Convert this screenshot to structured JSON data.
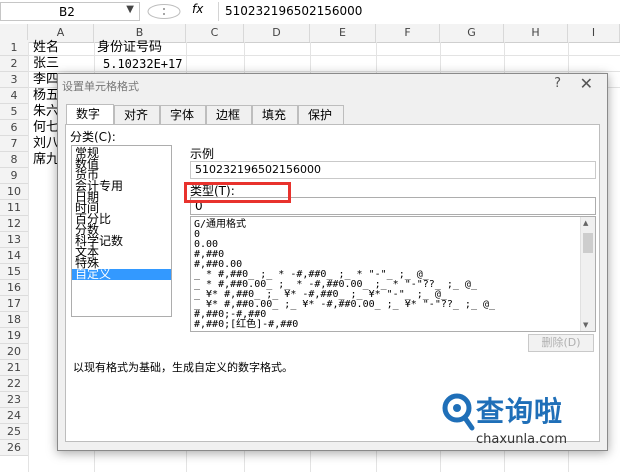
{
  "formula_bar": {
    "name_box": "B2",
    "dropdown_glyph": "▼",
    "dots": ":",
    "fx": "fx",
    "content": "510232196502156000"
  },
  "columns": [
    "A",
    "B",
    "C",
    "D",
    "E",
    "F",
    "G",
    "H",
    "I"
  ],
  "rows": [
    "1",
    "2",
    "3",
    "4",
    "5",
    "6",
    "7",
    "8",
    "9",
    "10",
    "11",
    "12",
    "13",
    "14",
    "15",
    "16",
    "17",
    "18",
    "19",
    "20",
    "21",
    "22",
    "23",
    "24",
    "25",
    "26"
  ],
  "cells": {
    "a1": "姓名",
    "b1": "身份证号码",
    "a2": "张三",
    "b2": "5.10232E+17",
    "a3": "李四",
    "a4": "杨五",
    "a5": "朱六",
    "a6": "何七",
    "a7": "刘八",
    "a8": "席九"
  },
  "dialog": {
    "title": "设置单元格格式",
    "help": "?",
    "close": "✕",
    "tabs": [
      "数字",
      "对齐",
      "字体",
      "边框",
      "填充",
      "保护"
    ],
    "category_label": "分类(C):",
    "categories": [
      "常规",
      "数值",
      "货币",
      "会计专用",
      "日期",
      "时间",
      "百分比",
      "分数",
      "科学记数",
      "文本",
      "特殊",
      "自定义"
    ],
    "selected_category": "自定义",
    "sample_label": "示例",
    "sample_value": "510232196502156000",
    "type_label": "类型(T):",
    "type_value": "0",
    "formats": [
      "G/通用格式",
      "0",
      "0.00",
      "#,##0",
      "#,##0.00",
      "_ * #,##0_ ;_ * -#,##0_ ;_ * \"-\"_ ;_ @_",
      "_ * #,##0.00_ ;_ * -#,##0.00_ ;_ * \"-\"??_ ;_ @_",
      "_ ¥* #,##0_ ;_ ¥* -#,##0_ ;_ ¥* \"-\"_ ;_ @_",
      "_ ¥* #,##0.00_ ;_ ¥* -#,##0.00_ ;_ ¥* \"-\"??_ ;_ @_",
      "#,##0;-#,##0",
      "#,##0;[红色]-#,##0"
    ],
    "delete_button": "删除(D)",
    "description": "以现有格式为基础，生成自定义的数字格式。"
  },
  "watermark": {
    "brand": "查询啦",
    "url": "chaxunla.com"
  },
  "colors": {
    "selection": "#3399ff",
    "highlight_box": "#e8322d",
    "brand": "#1f6fb8"
  }
}
